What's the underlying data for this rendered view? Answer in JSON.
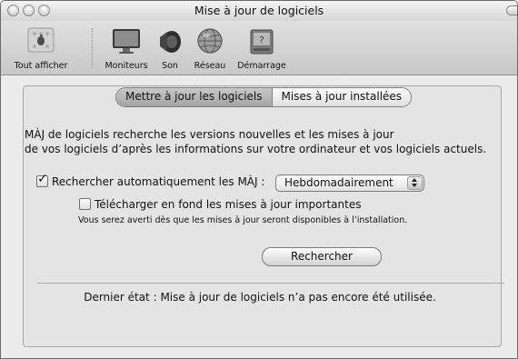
{
  "window": {
    "title": "Mise à jour de logiciels"
  },
  "toolbar": {
    "items": [
      {
        "label": "Tout afficher",
        "icon": "show-all-icon"
      },
      {
        "label": "Moniteurs",
        "icon": "display-icon"
      },
      {
        "label": "Son",
        "icon": "speaker-icon"
      },
      {
        "label": "Réseau",
        "icon": "network-globe-icon"
      },
      {
        "label": "Démarrage",
        "icon": "startup-disk-icon"
      }
    ]
  },
  "tabs": [
    {
      "label": "Mettre à jour les logiciels",
      "selected": true
    },
    {
      "label": "Mises à jour installées",
      "selected": false
    }
  ],
  "description": {
    "line1": "MÀJ de logiciels recherche les versions nouvelles et les mises à jour",
    "line2": "de vos logiciels d’après les informations sur votre ordinateur et vos logiciels actuels."
  },
  "auto_check": {
    "label": "Rechercher automatiquement les MÀJ :",
    "checked": true
  },
  "frequency": {
    "value": "Hebdomadairement"
  },
  "background_download": {
    "label": "Télécharger en fond les mises à jour importantes",
    "checked": false
  },
  "note": "Vous serez averti dès que les mises à jour seront disponibles à l’installation.",
  "check_button": "Rechercher",
  "status": "Dernier état : Mise à jour de logiciels n’a pas encore été utilisée."
}
